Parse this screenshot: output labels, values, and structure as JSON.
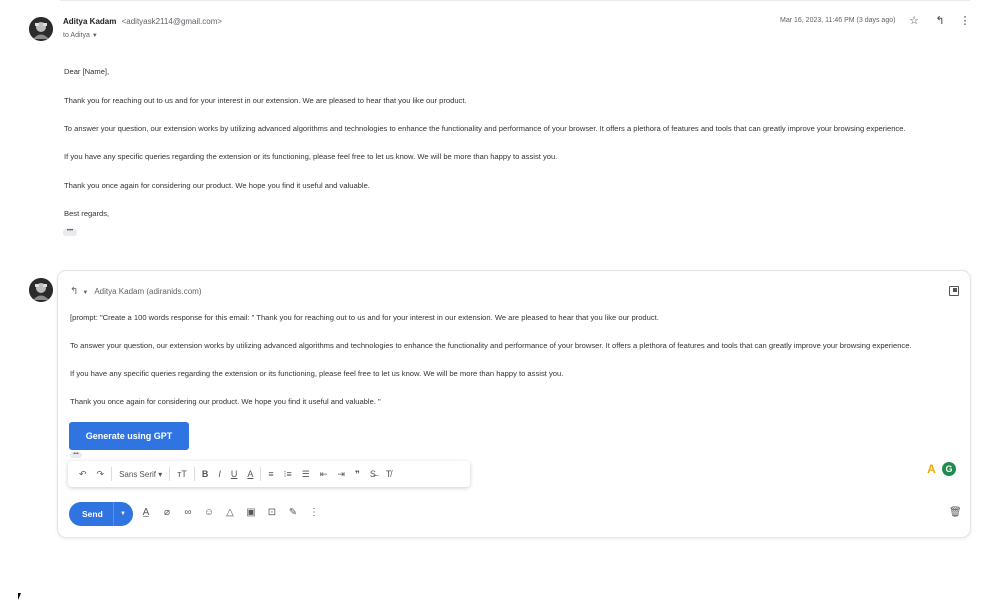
{
  "message": {
    "sender_name": "Aditya Kadam",
    "sender_email": "<adityask2114@gmail.com>",
    "to": "to Aditya",
    "date": "Mar 16, 2023, 11:46 PM (3 days ago)",
    "body": [
      "Dear [Name],",
      "Thank you for reaching out to us and for your interest in our extension. We are pleased to hear that you like our product.",
      "To answer your question, our extension works by utilizing advanced algorithms and technologies to enhance the functionality and performance of your browser. It offers a plethora of features and tools that can greatly improve your browsing experience.",
      "If you have any specific queries regarding the extension or its functioning, please feel free to let us know. We will be more than happy to assist you.",
      "Thank you once again for considering our product. We hope you find it useful and valuable.",
      "Best regards,"
    ],
    "trimmed_content": "•••"
  },
  "reply": {
    "recipient": "Aditya Kadam (adiranids.com)",
    "body": [
      "[prompt: \"Create a 100 words response for this email: \" Thank you for reaching out to us and for your interest in our extension. We are pleased to hear that you like our product.",
      "To answer your question, our extension works by utilizing advanced algorithms and technologies to enhance the functionality and performance of your browser. It offers a plethora of features and tools that can greatly improve your browsing experience.",
      "If you have any specific queries regarding the extension or its functioning, please feel free to let us know. We will be more than happy to assist you.",
      "Thank you once again for considering our product. We hope you find it useful and valuable. \""
    ],
    "generate_button": "Generate using GPT",
    "dots": "•••",
    "font_name": "Sans Serif",
    "send_label": "Send"
  },
  "icons": {
    "star": "☆",
    "reply": "↰",
    "more": "⋮",
    "undo": "↶",
    "redo": "↷",
    "text_size": "тT",
    "bold": "B",
    "italic": "I",
    "underline": "U",
    "text_color": "A",
    "align": "≡",
    "numbered_list": "⁝≡",
    "bulleted_list": "☰",
    "indent_less": "⇤",
    "indent_more": "⇥",
    "quote": "❞",
    "strikethrough": "S̶",
    "clear_format": "T̸",
    "formatting": "A̲",
    "attach": "⌀",
    "link": "∞",
    "emoji": "☺",
    "drive": "△",
    "photo": "▣",
    "lock": "⊡",
    "signature": "✎",
    "more_options": "⋮",
    "trash": "🗑",
    "ext_a": "A",
    "ext_g": "G"
  }
}
